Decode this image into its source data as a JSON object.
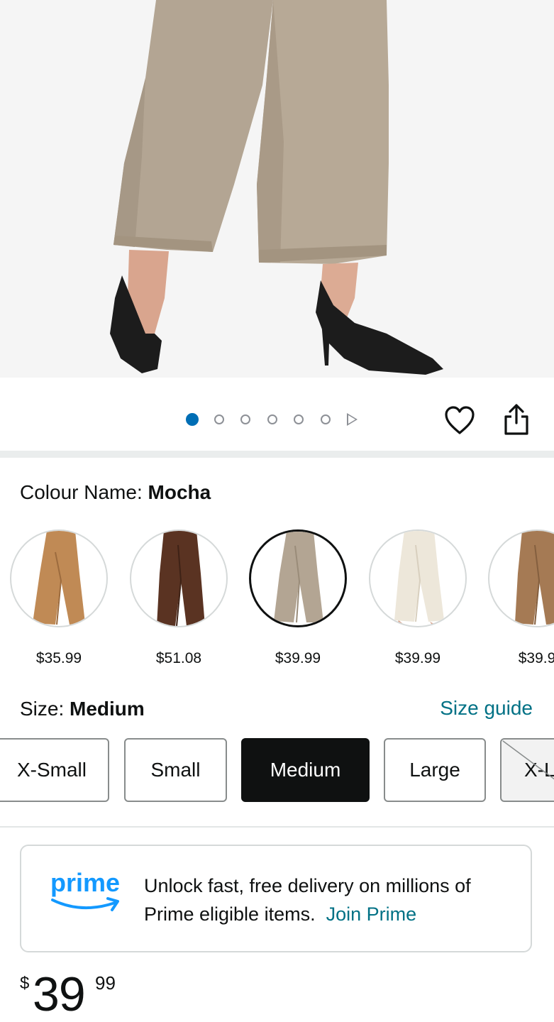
{
  "carousel": {
    "dot_count": 6,
    "active_index": 0
  },
  "colour": {
    "label": "Colour Name:",
    "value": "Mocha",
    "options": [
      {
        "name": "camel",
        "price": "$35.99",
        "color": "#c08a55"
      },
      {
        "name": "brown",
        "price": "$51.08",
        "color": "#5a3322"
      },
      {
        "name": "mocha",
        "price": "$39.99",
        "color": "#b3a593",
        "selected": true
      },
      {
        "name": "beige",
        "price": "$39.99",
        "color": "#ede7da"
      },
      {
        "name": "khaki",
        "price": "$39.9",
        "color": "#a57a54"
      }
    ]
  },
  "size": {
    "label": "Size:",
    "value": "Medium",
    "guide": "Size guide",
    "options": [
      "X-Small",
      "Small",
      "Medium",
      "Large",
      "X-L"
    ]
  },
  "prime": {
    "logo_text": "prime",
    "message": "Unlock fast, free delivery on millions of Prime eligible items.",
    "link": "Join Prime"
  },
  "price": {
    "currency": "$",
    "whole": "39",
    "fraction": "99"
  },
  "colors": {
    "link": "#007185",
    "active_dot": "#006eb5",
    "prime_blue": "#1399ff",
    "product": "#b3a593"
  }
}
